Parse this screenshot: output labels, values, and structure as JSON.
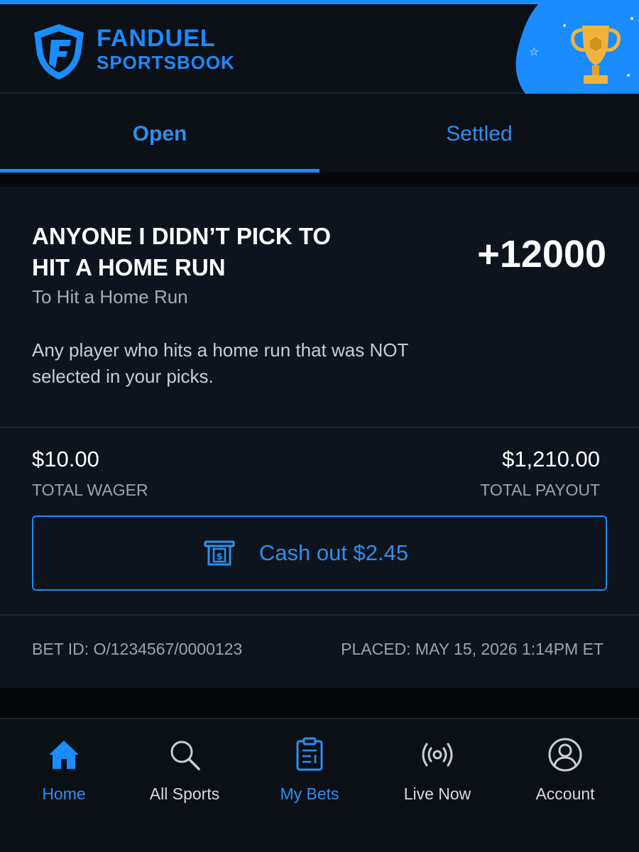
{
  "app": {
    "brand_top": "FANDUEL",
    "brand_bottom": "SPORTSBOOK",
    "accent_color": "#1a8cff"
  },
  "tabs": [
    {
      "label": "Open",
      "active": true
    },
    {
      "label": "Settled",
      "active": false
    }
  ],
  "bet": {
    "title": "ANYONE I DIDN’T PICK TO HIT A HOME RUN",
    "odds": "+12000",
    "market": "To Hit a Home Run",
    "description": "Any player who hits a home run that was NOT selected in your picks.",
    "total_wager_value": "$10.00",
    "total_wager_label": "TOTAL WAGER",
    "total_payout_value": "$1,210.00",
    "total_payout_label": "TOTAL PAYOUT",
    "cashout_label": "Cash out $2.45",
    "bet_id": "BET ID: O/1234567/0000123",
    "placed": "PLACED: MAY 15, 2026 1:14PM ET"
  },
  "nav": [
    {
      "label": "Home",
      "icon": "home-icon",
      "active": true
    },
    {
      "label": "All Sports",
      "icon": "search-icon",
      "active": false
    },
    {
      "label": "My Bets",
      "icon": "bet-slip-icon",
      "active": true
    },
    {
      "label": "Live Now",
      "icon": "live-broadcast-icon",
      "active": false
    },
    {
      "label": "Account",
      "icon": "account-icon",
      "active": false
    }
  ]
}
